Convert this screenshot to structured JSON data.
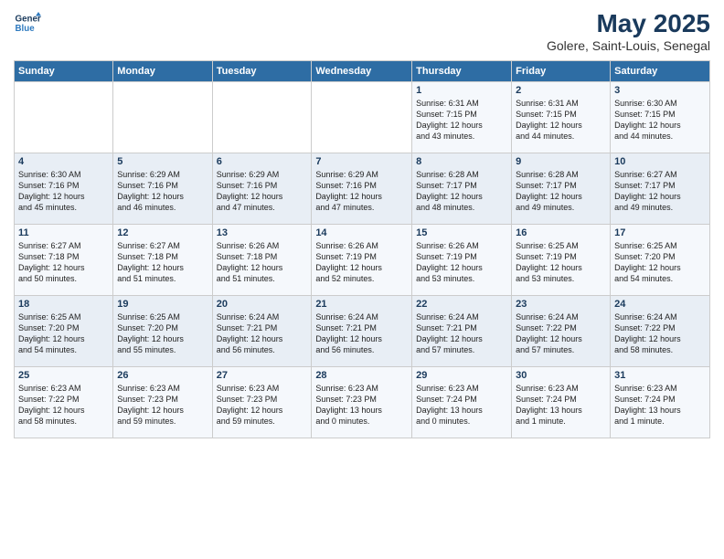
{
  "logo": {
    "line1": "General",
    "line2": "Blue"
  },
  "title": "May 2025",
  "subtitle": "Golere, Saint-Louis, Senegal",
  "weekdays": [
    "Sunday",
    "Monday",
    "Tuesday",
    "Wednesday",
    "Thursday",
    "Friday",
    "Saturday"
  ],
  "weeks": [
    [
      {
        "day": "",
        "info": ""
      },
      {
        "day": "",
        "info": ""
      },
      {
        "day": "",
        "info": ""
      },
      {
        "day": "",
        "info": ""
      },
      {
        "day": "1",
        "info": "Sunrise: 6:31 AM\nSunset: 7:15 PM\nDaylight: 12 hours\nand 43 minutes."
      },
      {
        "day": "2",
        "info": "Sunrise: 6:31 AM\nSunset: 7:15 PM\nDaylight: 12 hours\nand 44 minutes."
      },
      {
        "day": "3",
        "info": "Sunrise: 6:30 AM\nSunset: 7:15 PM\nDaylight: 12 hours\nand 44 minutes."
      }
    ],
    [
      {
        "day": "4",
        "info": "Sunrise: 6:30 AM\nSunset: 7:16 PM\nDaylight: 12 hours\nand 45 minutes."
      },
      {
        "day": "5",
        "info": "Sunrise: 6:29 AM\nSunset: 7:16 PM\nDaylight: 12 hours\nand 46 minutes."
      },
      {
        "day": "6",
        "info": "Sunrise: 6:29 AM\nSunset: 7:16 PM\nDaylight: 12 hours\nand 47 minutes."
      },
      {
        "day": "7",
        "info": "Sunrise: 6:29 AM\nSunset: 7:16 PM\nDaylight: 12 hours\nand 47 minutes."
      },
      {
        "day": "8",
        "info": "Sunrise: 6:28 AM\nSunset: 7:17 PM\nDaylight: 12 hours\nand 48 minutes."
      },
      {
        "day": "9",
        "info": "Sunrise: 6:28 AM\nSunset: 7:17 PM\nDaylight: 12 hours\nand 49 minutes."
      },
      {
        "day": "10",
        "info": "Sunrise: 6:27 AM\nSunset: 7:17 PM\nDaylight: 12 hours\nand 49 minutes."
      }
    ],
    [
      {
        "day": "11",
        "info": "Sunrise: 6:27 AM\nSunset: 7:18 PM\nDaylight: 12 hours\nand 50 minutes."
      },
      {
        "day": "12",
        "info": "Sunrise: 6:27 AM\nSunset: 7:18 PM\nDaylight: 12 hours\nand 51 minutes."
      },
      {
        "day": "13",
        "info": "Sunrise: 6:26 AM\nSunset: 7:18 PM\nDaylight: 12 hours\nand 51 minutes."
      },
      {
        "day": "14",
        "info": "Sunrise: 6:26 AM\nSunset: 7:19 PM\nDaylight: 12 hours\nand 52 minutes."
      },
      {
        "day": "15",
        "info": "Sunrise: 6:26 AM\nSunset: 7:19 PM\nDaylight: 12 hours\nand 53 minutes."
      },
      {
        "day": "16",
        "info": "Sunrise: 6:25 AM\nSunset: 7:19 PM\nDaylight: 12 hours\nand 53 minutes."
      },
      {
        "day": "17",
        "info": "Sunrise: 6:25 AM\nSunset: 7:20 PM\nDaylight: 12 hours\nand 54 minutes."
      }
    ],
    [
      {
        "day": "18",
        "info": "Sunrise: 6:25 AM\nSunset: 7:20 PM\nDaylight: 12 hours\nand 54 minutes."
      },
      {
        "day": "19",
        "info": "Sunrise: 6:25 AM\nSunset: 7:20 PM\nDaylight: 12 hours\nand 55 minutes."
      },
      {
        "day": "20",
        "info": "Sunrise: 6:24 AM\nSunset: 7:21 PM\nDaylight: 12 hours\nand 56 minutes."
      },
      {
        "day": "21",
        "info": "Sunrise: 6:24 AM\nSunset: 7:21 PM\nDaylight: 12 hours\nand 56 minutes."
      },
      {
        "day": "22",
        "info": "Sunrise: 6:24 AM\nSunset: 7:21 PM\nDaylight: 12 hours\nand 57 minutes."
      },
      {
        "day": "23",
        "info": "Sunrise: 6:24 AM\nSunset: 7:22 PM\nDaylight: 12 hours\nand 57 minutes."
      },
      {
        "day": "24",
        "info": "Sunrise: 6:24 AM\nSunset: 7:22 PM\nDaylight: 12 hours\nand 58 minutes."
      }
    ],
    [
      {
        "day": "25",
        "info": "Sunrise: 6:23 AM\nSunset: 7:22 PM\nDaylight: 12 hours\nand 58 minutes."
      },
      {
        "day": "26",
        "info": "Sunrise: 6:23 AM\nSunset: 7:23 PM\nDaylight: 12 hours\nand 59 minutes."
      },
      {
        "day": "27",
        "info": "Sunrise: 6:23 AM\nSunset: 7:23 PM\nDaylight: 12 hours\nand 59 minutes."
      },
      {
        "day": "28",
        "info": "Sunrise: 6:23 AM\nSunset: 7:23 PM\nDaylight: 13 hours\nand 0 minutes."
      },
      {
        "day": "29",
        "info": "Sunrise: 6:23 AM\nSunset: 7:24 PM\nDaylight: 13 hours\nand 0 minutes."
      },
      {
        "day": "30",
        "info": "Sunrise: 6:23 AM\nSunset: 7:24 PM\nDaylight: 13 hours\nand 1 minute."
      },
      {
        "day": "31",
        "info": "Sunrise: 6:23 AM\nSunset: 7:24 PM\nDaylight: 13 hours\nand 1 minute."
      }
    ]
  ]
}
